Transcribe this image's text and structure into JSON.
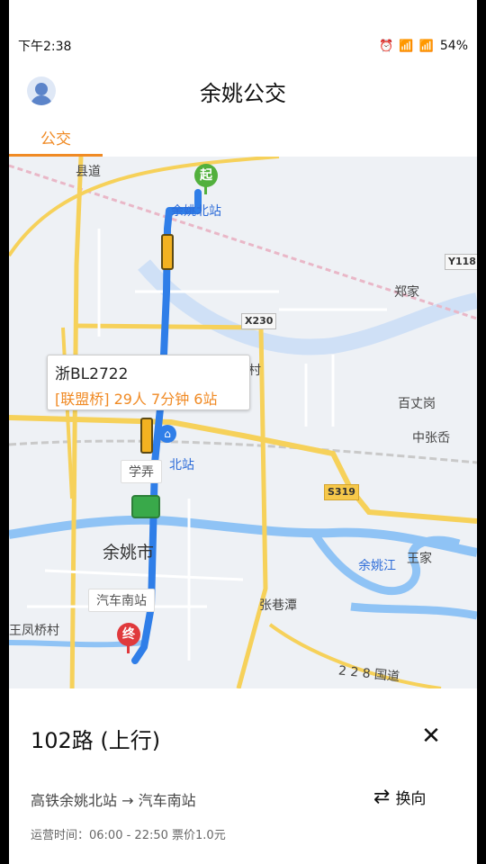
{
  "status_bar": {
    "time": "下午2:38",
    "battery": "54%",
    "icons": "⏰ 📶 📶"
  },
  "header": {
    "title": "余姚公交"
  },
  "tabs": [
    {
      "label": "公交"
    }
  ],
  "map": {
    "labels": {
      "county_road": "县道",
      "yuyao_north_station": "余姚北站",
      "zhengjia": "郑家",
      "baizhanggang": "百丈岗",
      "zhongzhangdang": "中张岙",
      "yuyao_city": "余姚市",
      "yuyao_river": "余姚江",
      "wangjia": "王家",
      "zhangxiangtan": "张巷潭",
      "wangfengqiao": "王凤桥村",
      "village": "东光村",
      "north_station_2": "北站",
      "national_road": "2 2 8 国道"
    },
    "road_badges": {
      "y118": "Y118",
      "x230": "X230",
      "s319": "S319"
    },
    "markers": {
      "start": "起",
      "end": "终"
    },
    "bus_info": {
      "plate": "浙BL2722",
      "status": "[联盟桥] 29人 7分钟 6站"
    },
    "station_tags": {
      "xuenong": "学弄",
      "bus_south": "汽车南站"
    }
  },
  "route": {
    "name": "102路 (上行)",
    "direction": "高铁余姚北站 → 汽车南站",
    "swap_label": "换向",
    "hours": "运营时间：06:00 - 22:50   票价1.0元"
  }
}
